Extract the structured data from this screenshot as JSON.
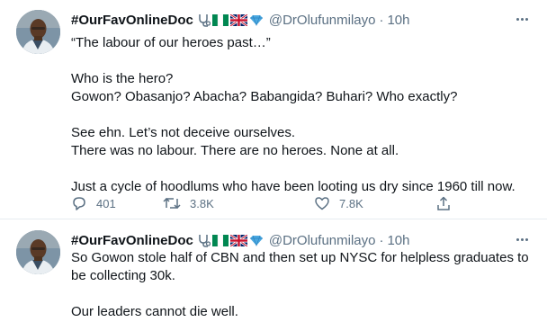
{
  "tweets": [
    {
      "author": {
        "name": "#OurFavOnlineDoc",
        "handle": "@DrOlufunmilayo",
        "badges": [
          "stethoscope-icon",
          "nigeria-flag-icon",
          "uk-flag-icon",
          "blue-diamond-icon"
        ]
      },
      "separator": "·",
      "time": "10h",
      "lines": [
        "“The labour of our heroes past…”",
        "",
        "Who is the hero?",
        "Gowon? Obasanjo? Abacha? Babangida? Buhari? Who exactly?",
        "",
        "See ehn. Let’s not deceive ourselves.",
        "There was no labour. There are no heroes. None at all.",
        "",
        "Just a cycle of hoodlums who have been looting us dry since 1960 till now."
      ],
      "actions": {
        "replies": "401",
        "retweets": "3.8K",
        "likes": "7.8K"
      }
    },
    {
      "author": {
        "name": "#OurFavOnlineDoc",
        "handle": "@DrOlufunmilayo",
        "badges": [
          "stethoscope-icon",
          "nigeria-flag-icon",
          "uk-flag-icon",
          "blue-diamond-icon"
        ]
      },
      "separator": "·",
      "time": "10h",
      "lines": [
        "So Gowon stole half of CBN and then set up NYSC for helpless graduates to",
        "be collecting 30k.",
        "",
        "Our leaders cannot die well."
      ]
    }
  ],
  "colors": {
    "text": "#0f1419",
    "secondary": "#5b7083",
    "divider": "#e6ecf0",
    "nigeria_green": "#008751",
    "diamond_blue": "#4aa8e0"
  }
}
